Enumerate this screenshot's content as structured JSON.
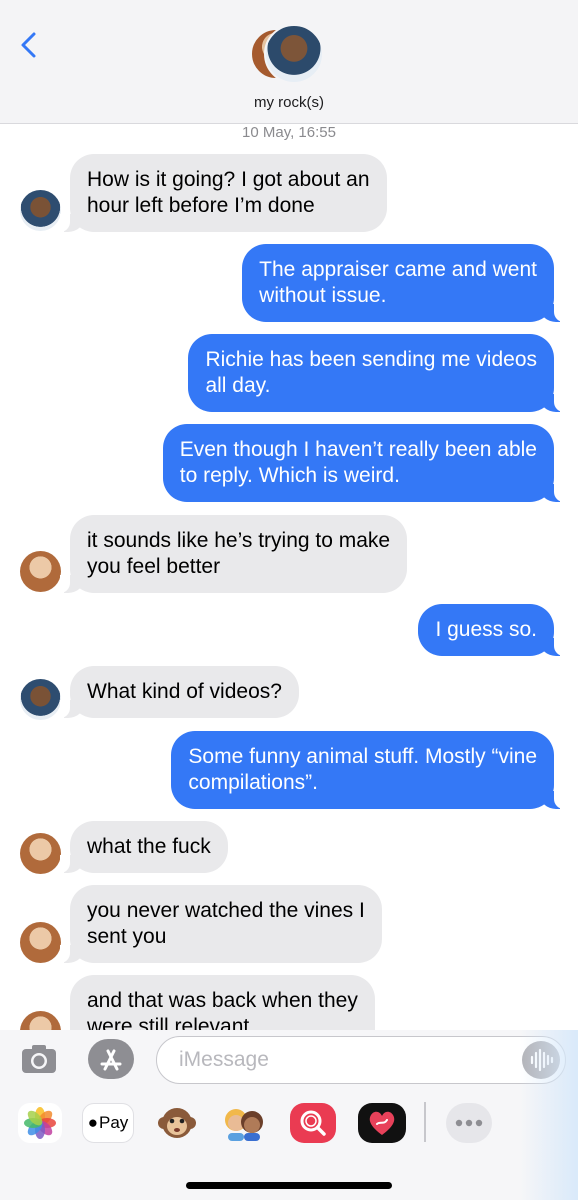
{
  "header": {
    "back_icon": "chevron-left-icon",
    "contact_name": "my rock(s)"
  },
  "timestamp": "10 May, 16:55",
  "messages": [
    {
      "side": "incoming",
      "sender": "man",
      "text": "How is it going? I got about an\nhour left before I’m done"
    },
    {
      "side": "outgoing",
      "text": "The appraiser came and went\nwithout issue."
    },
    {
      "side": "outgoing",
      "text": "Richie has been sending me videos\nall day."
    },
    {
      "side": "outgoing",
      "text": "Even though I haven’t really been able\nto reply. Which is weird."
    },
    {
      "side": "incoming",
      "sender": "woman",
      "text": "it sounds like he’s trying to make\nyou feel better"
    },
    {
      "side": "outgoing",
      "text": "I guess so."
    },
    {
      "side": "incoming",
      "sender": "man",
      "text": "What kind of videos?"
    },
    {
      "side": "outgoing",
      "text": "Some funny animal stuff. Mostly “vine\ncompilations”."
    },
    {
      "side": "incoming",
      "sender": "woman",
      "text": "what the fuck"
    },
    {
      "side": "incoming",
      "sender": "woman",
      "text": "you never watched the vines I\nsent you"
    },
    {
      "side": "incoming",
      "sender": "woman",
      "text": "and that was back when they\nwere still relevant"
    }
  ],
  "input": {
    "placeholder": "iMessage",
    "value": ""
  },
  "app_drawer": {
    "pay_label": "Pay",
    "items": [
      "photos-icon",
      "apple-pay-icon",
      "monkey-emoji-icon",
      "memoji-icon",
      "search-images-icon",
      "digital-touch-icon",
      "more-icon"
    ]
  },
  "colors": {
    "outgoing_bubble": "#3478f6",
    "incoming_bubble": "#e9e9eb",
    "accent": "#3478f6"
  }
}
